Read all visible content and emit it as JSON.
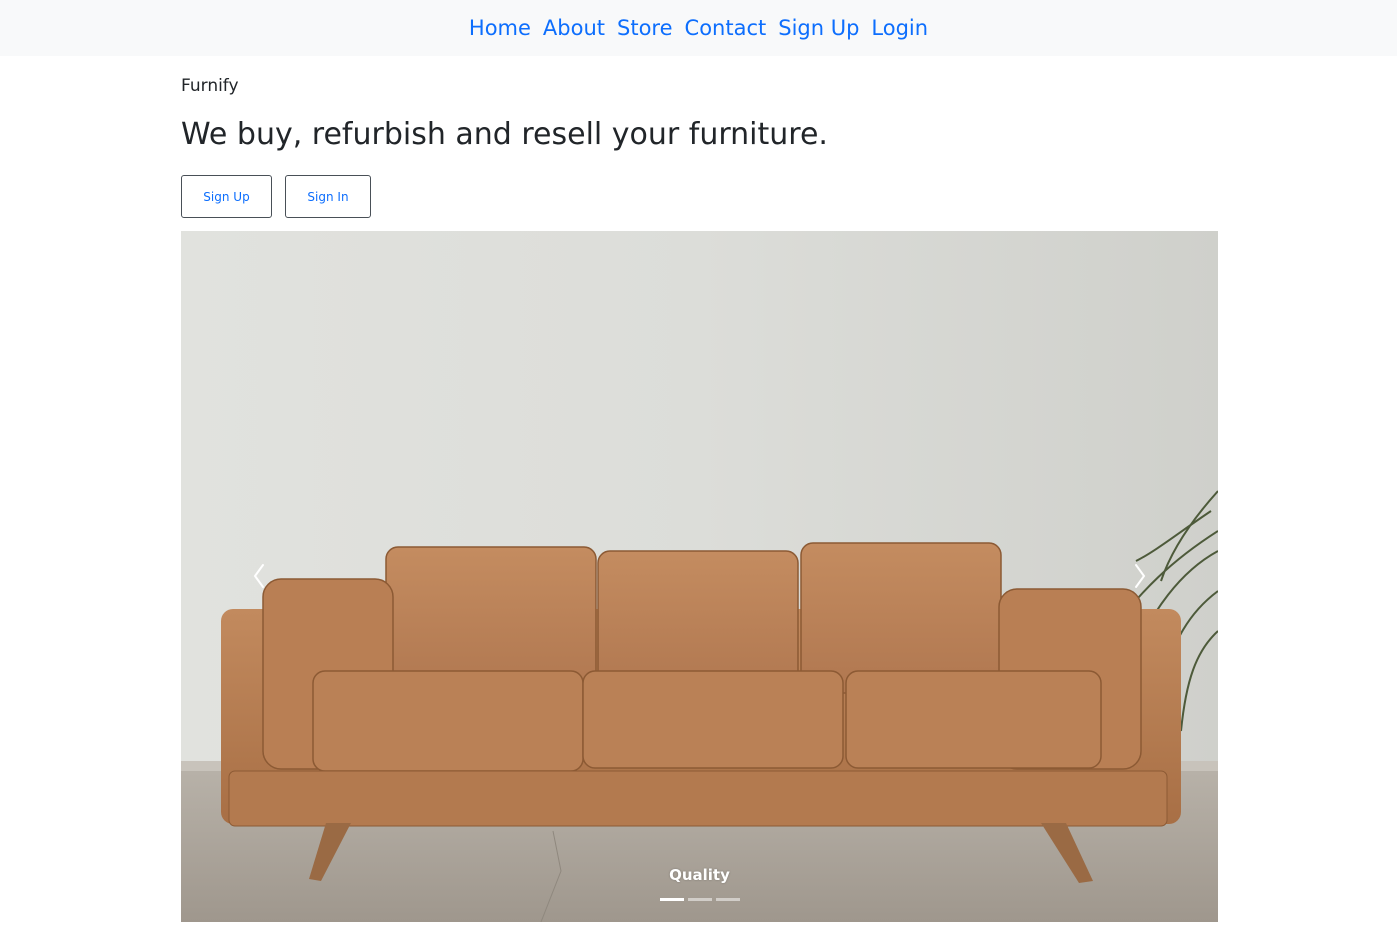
{
  "nav": {
    "items": [
      {
        "label": "Home"
      },
      {
        "label": "About"
      },
      {
        "label": "Store"
      },
      {
        "label": "Contact"
      },
      {
        "label": "Sign Up"
      },
      {
        "label": "Login"
      }
    ]
  },
  "hero": {
    "brand": "Furnify",
    "headline": "We buy, refurbish and resell your furniture.",
    "signup_label": "Sign Up",
    "signin_label": "Sign In"
  },
  "carousel": {
    "caption": "Quality",
    "slide_count": 3,
    "active_index": 0,
    "image": "brown-leather-sofa-photo",
    "prev_icon": "chevron-left-icon",
    "next_icon": "chevron-right-icon"
  },
  "colors": {
    "link": "#0d6efd",
    "nav_bg": "#f8f9fa",
    "text": "#212529"
  }
}
